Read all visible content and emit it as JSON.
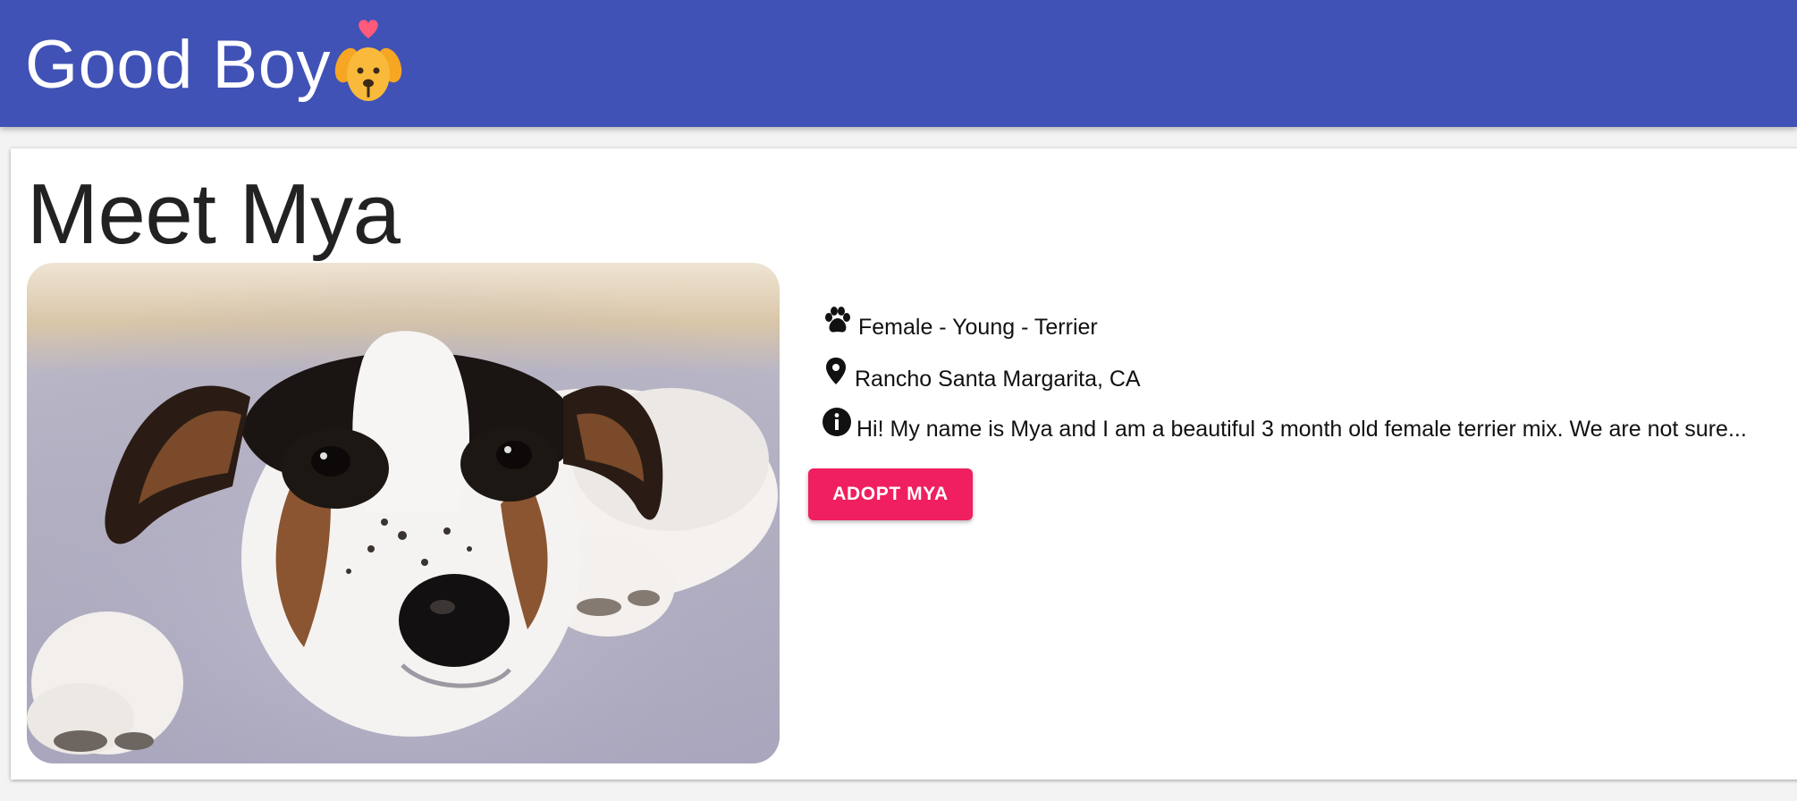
{
  "app": {
    "brand": "Good Boy",
    "logo_icon": "dog-heart-icon",
    "primary_color": "#4052b5",
    "accent_color": "#f01f5f"
  },
  "profile": {
    "title": "Meet Mya",
    "photo_icon": "dog-photo",
    "details": [
      {
        "icon": "paw-icon",
        "text": "Female - Young - Terrier"
      },
      {
        "icon": "location-pin-icon",
        "text": "Rancho Santa Margarita, CA"
      },
      {
        "icon": "info-icon",
        "text": "Hi! My name is Mya and I am a beautiful 3 month old female terrier mix. We are not sure..."
      }
    ],
    "adopt_button": "ADOPT MYA"
  }
}
